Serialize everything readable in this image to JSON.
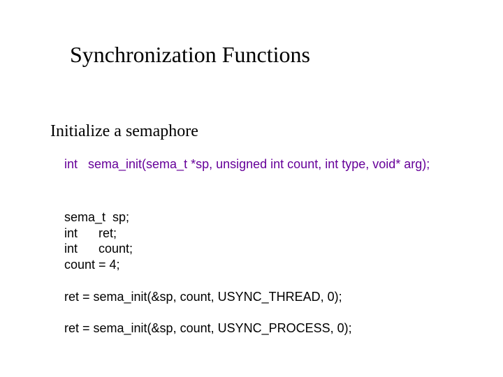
{
  "title": "Synchronization Functions",
  "subtitle": "Initialize a semaphore",
  "signature": "int   sema_init(sema_t *sp, unsigned int count, int type, void* arg);",
  "code_lines": "sema_t  sp;\nint      ret;\nint      count;\ncount = 4;",
  "call1": "ret = sema_init(&sp, count, USYNC_THREAD, 0);",
  "call2": "ret = sema_init(&sp, count, USYNC_PROCESS, 0);"
}
